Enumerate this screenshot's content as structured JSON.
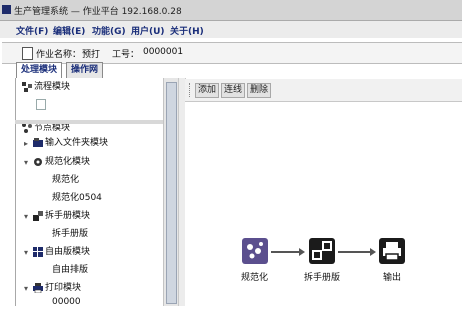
{
  "window": {
    "title": "生产管理系统 — 作业平台 192.168.0.28"
  },
  "menu": [
    "文件(F)",
    "编辑(E)",
    "功能(G)",
    "用户(U)",
    "关于(H)"
  ],
  "info": {
    "name_label": "作业名称：",
    "name_value": "预打",
    "id_label": "工号：",
    "id_value": "0000001"
  },
  "tabs": [
    "处理模块",
    "操作网"
  ],
  "tree": {
    "top": "流程模块",
    "root": "节点模块",
    "items": [
      {
        "label": "输入文件夹模块",
        "level": 1,
        "expander": "plus"
      },
      {
        "label": "规范化模块",
        "level": 1,
        "expander": "minus"
      },
      {
        "label": "规范化",
        "level": 2
      },
      {
        "label": "规范化0504",
        "level": 2
      },
      {
        "label": "拆手册模块",
        "level": 1,
        "expander": "minus"
      },
      {
        "label": "拆手册版",
        "level": 2
      },
      {
        "label": "自由版模块",
        "level": 1,
        "expander": "minus"
      },
      {
        "label": "自由排版",
        "level": 2
      },
      {
        "label": "打印模块",
        "level": 1,
        "expander": "minus"
      },
      {
        "label": "00000",
        "level": 2
      }
    ]
  },
  "toolbar": {
    "buttons": [
      "添加",
      "连线",
      "删除"
    ]
  },
  "workflow": {
    "nodes": [
      {
        "label": "规范化",
        "icon": "normalize-icon"
      },
      {
        "label": "拆手册版",
        "icon": "split-icon"
      },
      {
        "label": "输出",
        "icon": "printer-icon"
      }
    ]
  },
  "colors": {
    "menu_text": "#1a2e7a",
    "title_icon": "#1e2b6a",
    "node_normalize": "#5b4f8e",
    "node_dark": "#1b1b1b"
  }
}
